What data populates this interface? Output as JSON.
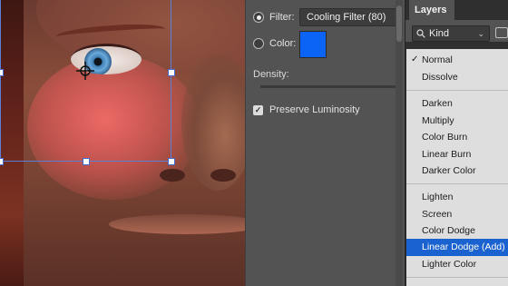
{
  "properties": {
    "filter_label": "Filter:",
    "filter_value": "Cooling Filter (80)",
    "color_label": "Color:",
    "color_swatch": "#0b64f5",
    "density_label": "Density:",
    "preserve_label": "Preserve Luminosity",
    "preserve_checked": true
  },
  "layers": {
    "tab_label": "Layers",
    "kind_label": "Kind",
    "search_icon": "magnifier-icon"
  },
  "blend_menu": {
    "items": [
      {
        "label": "Normal",
        "checked": true
      },
      {
        "label": "Dissolve"
      },
      {
        "label": "Darken"
      },
      {
        "label": "Multiply"
      },
      {
        "label": "Color Burn"
      },
      {
        "label": "Linear Burn"
      },
      {
        "label": "Darker Color"
      },
      {
        "label": "Lighten"
      },
      {
        "label": "Screen"
      },
      {
        "label": "Color Dodge"
      },
      {
        "label": "Linear Dodge (Add)",
        "selected": true
      },
      {
        "label": "Lighter Color"
      }
    ],
    "selected_color": "#1b62d1"
  }
}
